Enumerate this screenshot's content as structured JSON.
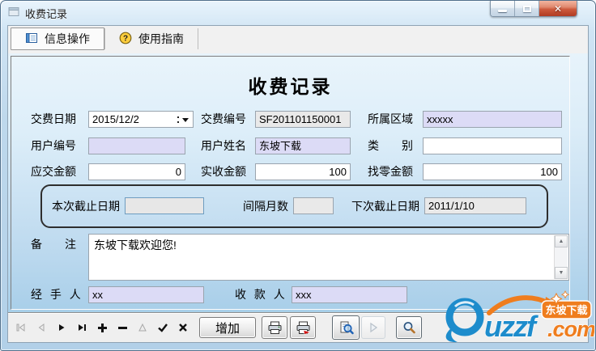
{
  "window": {
    "title": "收费记录"
  },
  "tabs": [
    {
      "label": "信息操作"
    },
    {
      "label": "使用指南"
    }
  ],
  "form": {
    "heading": "收费记录",
    "fields": {
      "pay_date": {
        "label": "交费日期",
        "value": "2015/12/2"
      },
      "pay_no": {
        "label": "交费编号",
        "value": "SF201101150001"
      },
      "region": {
        "label": "所属区域",
        "value": "xxxxx"
      },
      "user_no": {
        "label": "用户编号",
        "value": ""
      },
      "user_name": {
        "label": "用户姓名",
        "value": "东坡下载"
      },
      "category": {
        "label": "类　　别",
        "value": ""
      },
      "amount_due": {
        "label": "应交金额",
        "value": "0"
      },
      "amount_received": {
        "label": "实收金额",
        "value": "100"
      },
      "change_amount": {
        "label": "找零金额",
        "value": "100"
      },
      "current_deadline": {
        "label": "本次截止日期",
        "value": ""
      },
      "interval_months": {
        "label": "间隔月数",
        "value": ""
      },
      "next_deadline": {
        "label": "下次截止日期",
        "value": "2011/1/10"
      },
      "remarks": {
        "label": "备　　注",
        "value": "东坡下载欢迎您!"
      },
      "handler": {
        "label": "经 手 人",
        "value": "xx"
      },
      "payee": {
        "label": "收 款 人",
        "value": "xxx"
      }
    }
  },
  "toolbar": {
    "add_label": "增加"
  },
  "watermark": {
    "text_main": "uzzf",
    "text_com": ".com",
    "badge": "东坡下载"
  },
  "icons": {
    "close": "✕",
    "question": "?",
    "scroll_up": "▲",
    "scroll_down": "▼"
  },
  "colors": {
    "logo_blue": "#1d8ccc",
    "logo_orange": "#ef7d1e",
    "field_lavender": "#dcdbf6",
    "field_readonly": "#e9e9e9",
    "close_red": "#c0452e"
  }
}
